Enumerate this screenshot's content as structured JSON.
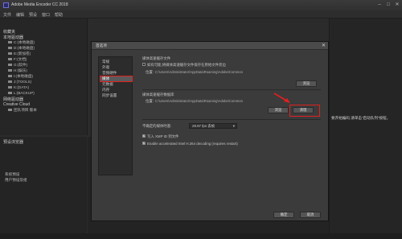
{
  "app": {
    "title": "Adobe Media Encoder CC 2018"
  },
  "window_controls": [
    "–",
    "□",
    "✕"
  ],
  "menu": [
    "文件",
    "编辑",
    "预设",
    "窗口",
    "帮助"
  ],
  "left_panel": {
    "tab_title": "收藏夹",
    "section": "本地驱动器",
    "drives": [
      "C:(本地磁盘)",
      "D:(本地磁盘)",
      "E:(新加卷)",
      "F:(文档)",
      "G:(软件)",
      "H:(娱乐)",
      "I:(本地磁盘)",
      "J:(TOOLS)",
      "K:(DATA)",
      "L:(BACKUP)"
    ],
    "section2": "网络驱动器",
    "section3": "Creative Cloud",
    "cc_item": "团队项目 版本"
  },
  "left_bottom": {
    "title": "预设浏览器",
    "items": [
      "系统预设",
      "用户预设及组"
    ]
  },
  "right_panel": {
    "hint": "要开始编码,请单击“启动队列”按钮。"
  },
  "dialog": {
    "title": "首选项",
    "close": "✕",
    "nav": [
      "常规",
      "外观",
      "音频硬件",
      "媒体",
      "元数据",
      "内存",
      "同步设置"
    ],
    "selected_nav": "媒体",
    "cache_db_header": "媒体高速缓存文件",
    "cache_checkbox": "如有可能,将媒体高速缓存文件保存在原始文件旁边",
    "location_label": "位置:",
    "cache_files_path": "C:\\Users\\Administrator\\AppData\\Roaming\\Adobe\\Common",
    "browse_label": "浏览",
    "db_header": "媒体高速缓存数据库",
    "db_path": "C:\\Users\\Administrator\\AppData\\Roaming\\Adobe\\Common",
    "clean_label": "清理",
    "clean_button_text": "清理",
    "browse2_label": "浏览",
    "timecode_label": "不确定的媒体时基:",
    "timecode_value": "29.97 fps 丢帧",
    "import_checkbox": "写入 XMP ID 到文件",
    "hw_checkbox": "Enable accelerated Intel H.264 decoding (requires restart)",
    "ok": "确定",
    "cancel": "取消"
  }
}
